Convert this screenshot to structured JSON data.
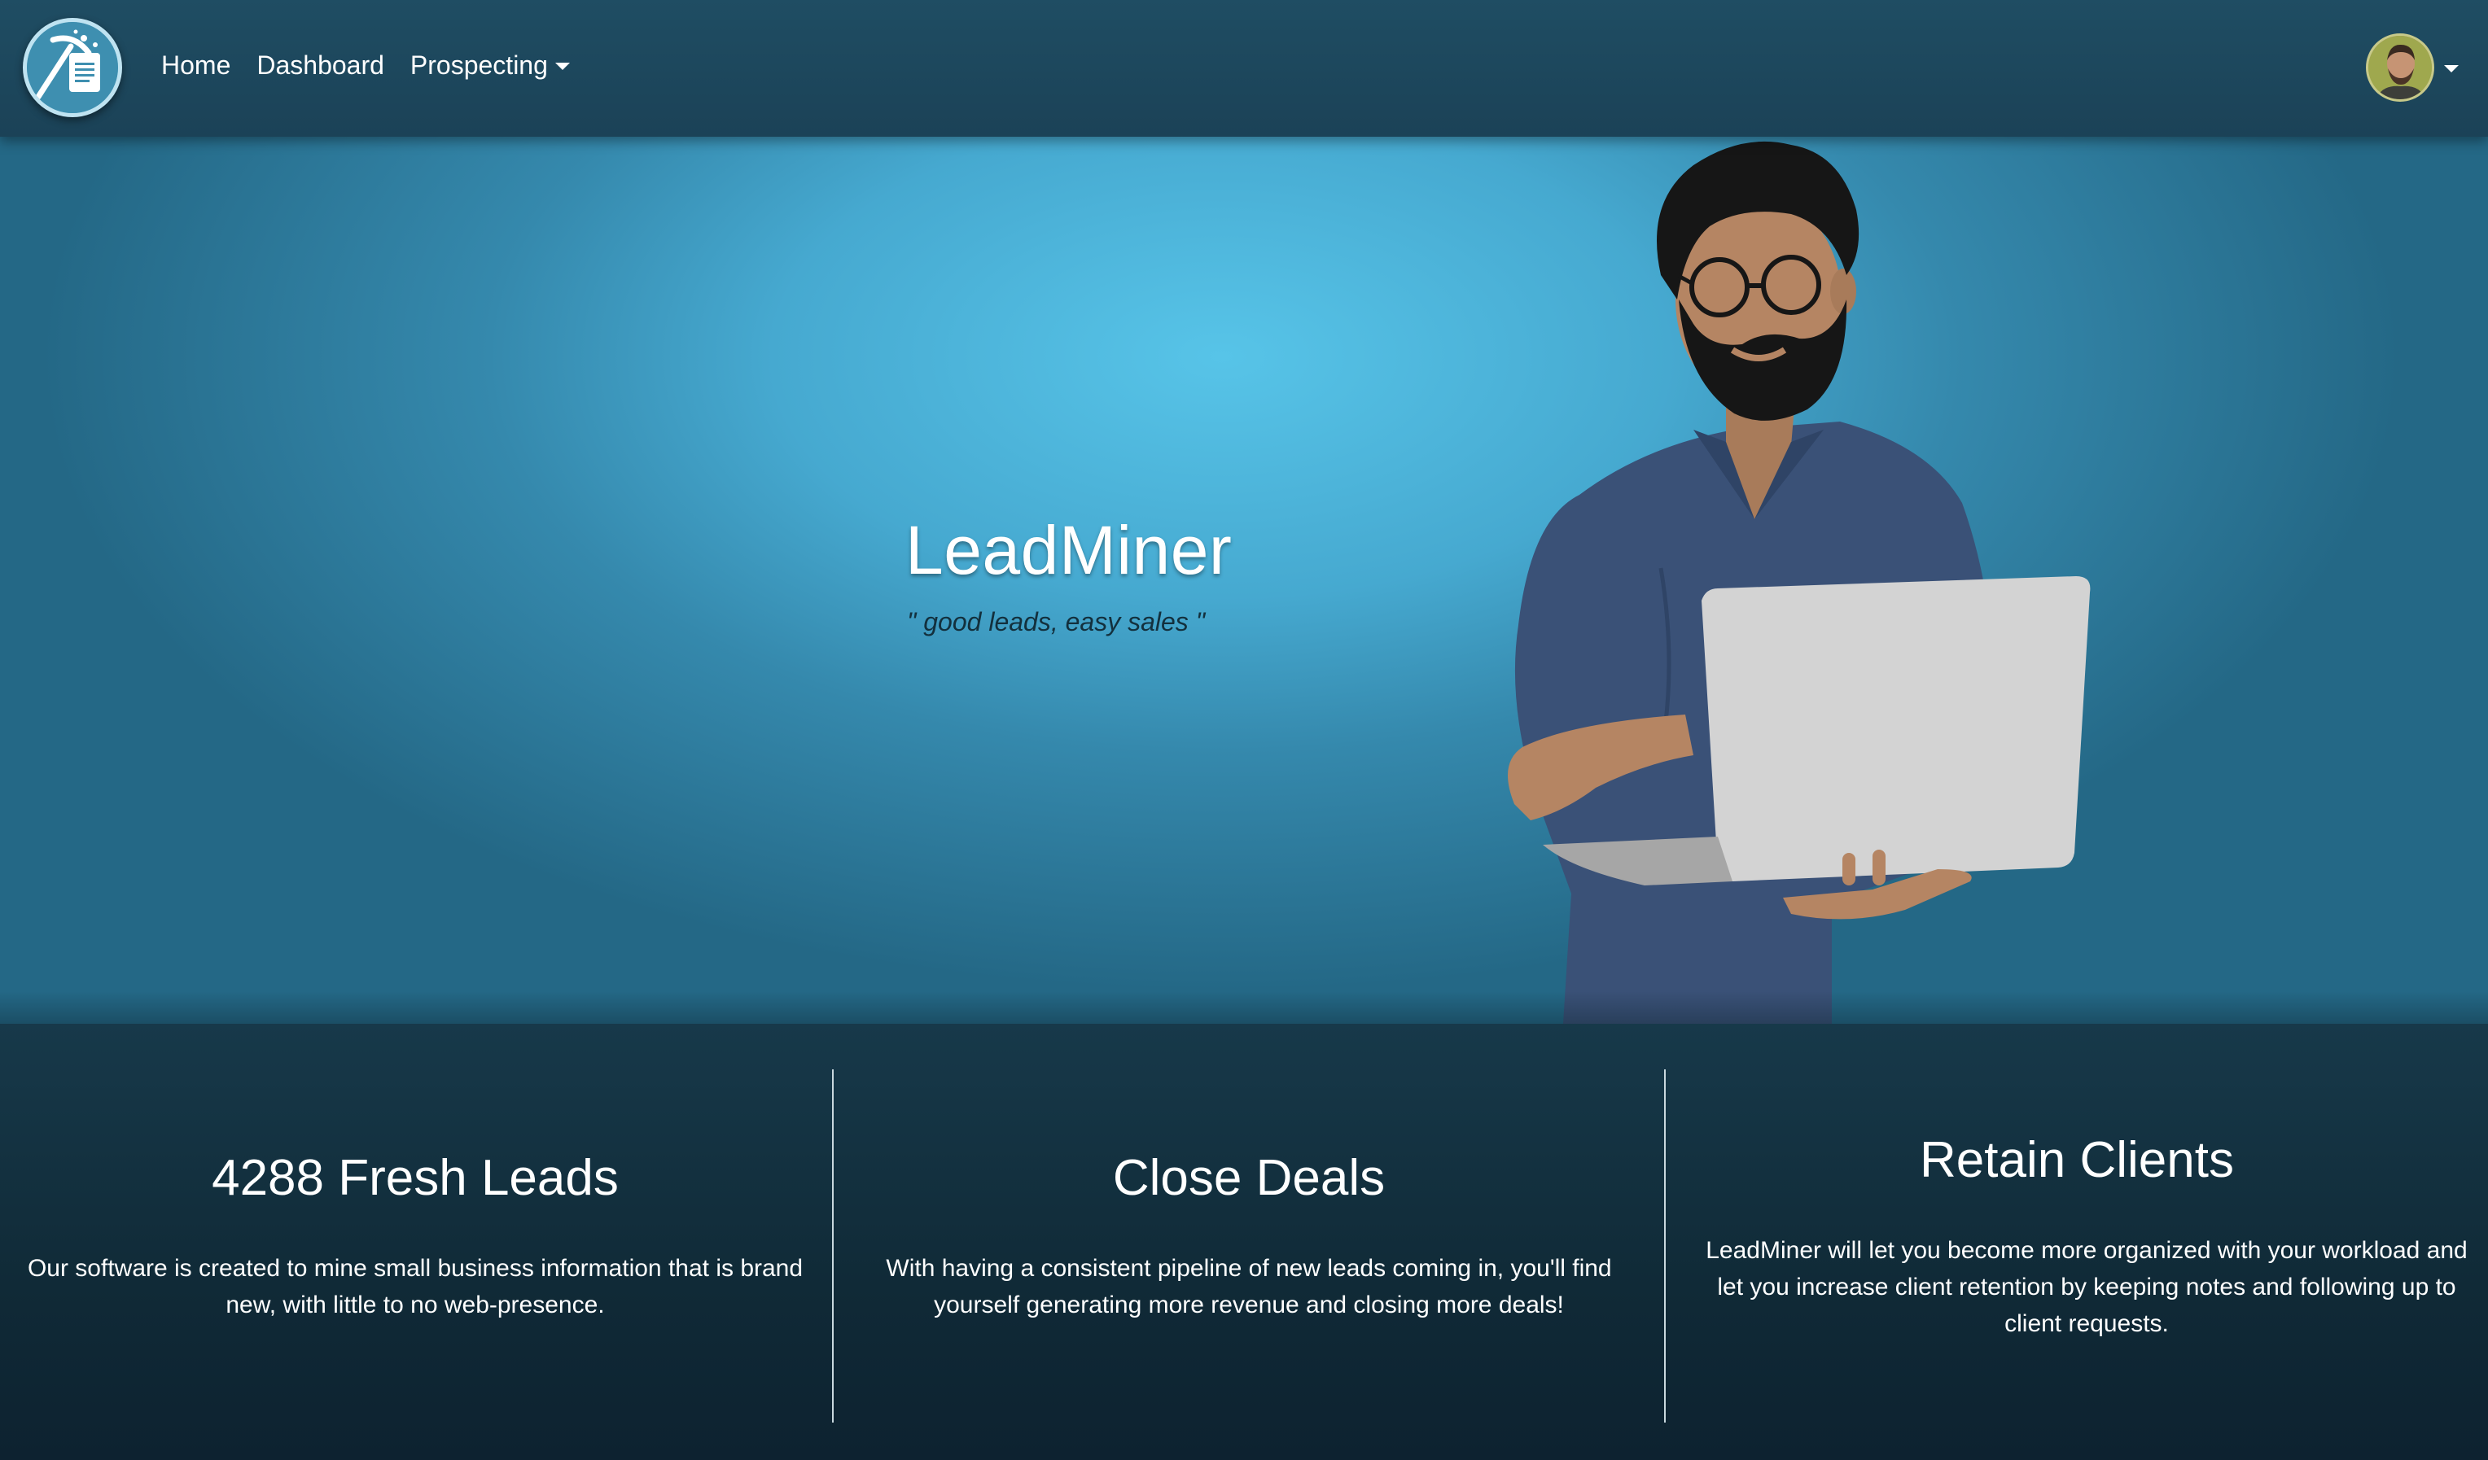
{
  "nav": {
    "brand_icon": "pickaxe-document-logo",
    "links": [
      {
        "label": "Home"
      },
      {
        "label": "Dashboard"
      },
      {
        "label": "Prospecting",
        "icon": "caret-down-icon"
      }
    ],
    "user_icon": "user-avatar"
  },
  "hero": {
    "title": "LeadMiner",
    "tagline": "\" good leads, easy sales \""
  },
  "features": [
    {
      "title": "4288 Fresh Leads",
      "text": "Our software is created to mine small business information that is brand new, with little to no web-presence."
    },
    {
      "title": "Close Deals",
      "text": "With having a consistent pipeline of new leads coming in, you'll find yourself generating more revenue and closing more deals!"
    },
    {
      "title": "Retain Clients",
      "text": "LeadMiner will let you become more organized with your workload and let you increase client retention by keeping notes and following up to client requests."
    }
  ],
  "colors": {
    "navbar": "#1f4d63",
    "hero_center": "#57c4e8",
    "hero_edge": "#246886",
    "features_bg": "#102a37",
    "divider": "#c9d8de",
    "shirt": "#3a5177",
    "skin": "#b58563",
    "laptop": "#d3d3d3"
  }
}
